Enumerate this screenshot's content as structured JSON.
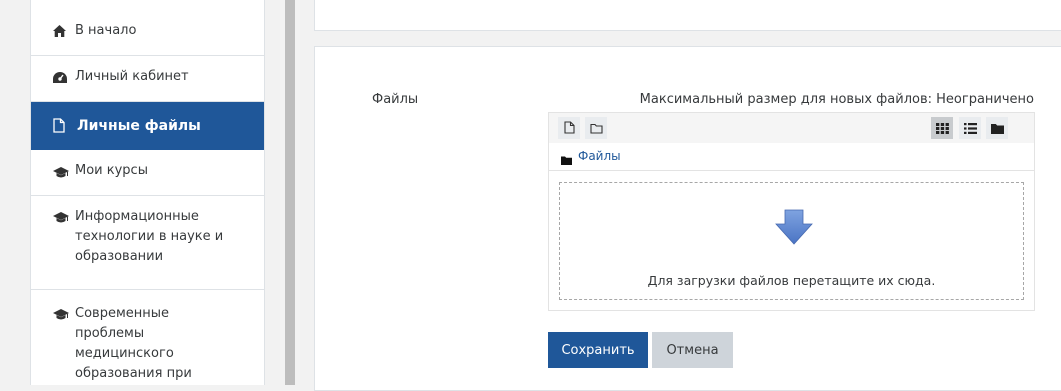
{
  "nav": {
    "items": [
      {
        "label": "В начало",
        "icon": "home-icon"
      },
      {
        "label": "Личный кабинет",
        "icon": "dashboard-icon"
      },
      {
        "label": "Личные файлы",
        "icon": "file-icon",
        "active": true
      },
      {
        "label": "Мои курсы",
        "icon": "graduation-cap-icon"
      },
      {
        "label_lines": [
          "Информационные",
          "технологии в науке и",
          "образовании"
        ],
        "icon": "graduation-cap-icon"
      },
      {
        "label_lines": [
          "Современные",
          "проблемы",
          "медицинского",
          "образования при"
        ],
        "icon": "graduation-cap-icon"
      }
    ]
  },
  "form": {
    "files_label": "Файлы",
    "max_size_text": "Максимальный размер для новых файлов: Неограничено",
    "path_label": "Файлы",
    "drop_text": "Для загрузки файлов перетащите их сюда.",
    "save_label": "Сохранить",
    "cancel_label": "Отмена"
  },
  "colors": {
    "accent": "#1f5799",
    "drop_arrow": "#5b86d0",
    "cancel_bg": "#ced4da"
  }
}
